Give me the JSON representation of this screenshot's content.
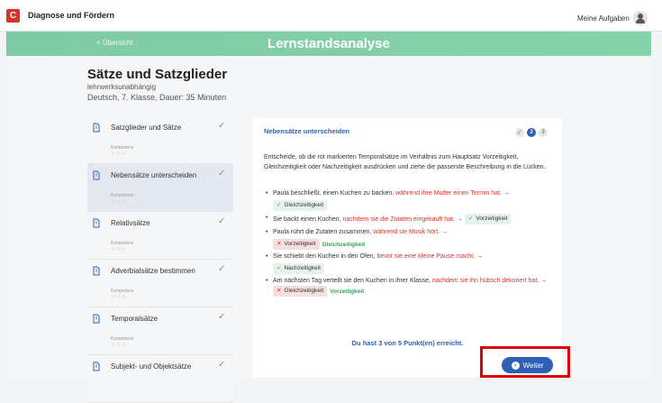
{
  "app": {
    "title": "Diagnose und Fördern",
    "logo_letter": "C",
    "tasks_link": "Meine Aufgaben"
  },
  "header": {
    "back_label": "< Übersicht",
    "title": "Lernstandsanalyse"
  },
  "test": {
    "title": "Sätze und Satzglieder",
    "subtitle": "lehrwerksunabhängig",
    "meta": "Deutsch, 7. Klasse, Dauer: 35 Minuten"
  },
  "sidebar": {
    "items": [
      {
        "label": "Satzglieder und Sätze",
        "competence": "Kompetenz",
        "stars": "☆☆☆",
        "check": "✓"
      },
      {
        "label": "Nebensätze unterscheiden",
        "competence": "Kompetenz",
        "stars": "☆☆☆",
        "check": "✓"
      },
      {
        "label": "Relativsätze",
        "competence": "Kompetenz",
        "stars": "☆☆☆",
        "check": "✓"
      },
      {
        "label": "Adverbialsätze bestimmen",
        "competence": "Kompetenz",
        "stars": "☆☆☆",
        "check": "✓"
      },
      {
        "label": "Temporalsätze",
        "competence": "Kompetenz",
        "stars": "☆☆☆",
        "check": "✓"
      },
      {
        "label": "Subjekt- und Objektsätze",
        "competence": "",
        "stars": "",
        "check": "✓"
      }
    ]
  },
  "task": {
    "title": "Nebensätze unterscheiden",
    "steps": {
      "done": "✓",
      "current": "2",
      "next": "3"
    },
    "intro": "Entscheide, ob die rot markierten Temporalsätze im Verhältnis zum Hauptsatz Vorzeitigkeit, Gleichzeitigkeit oder Nachzeitigkeit ausdrücken und ziehe die passende Beschreibung in die Lücken.",
    "items": [
      {
        "pre": "Paula beschließt, einen Kuchen zu backen, ",
        "red": "während ihre Mutter einen Termin hat.",
        "post": " →",
        "answer": "Gleichzeitigkeit"
      },
      {
        "pre": "Sie backt einen Kuchen, ",
        "red": "nachdem sie die Zutaten eingekauft hat.",
        "post": " →",
        "answer": "Vorzeitigkeit"
      },
      {
        "pre": "Paula rührt die Zutaten zusammen, ",
        "red": "während sie Musik hört.",
        "post": " →",
        "answer": "Vorzeitigkeit",
        "correct": "Gleichzeitigkeit"
      },
      {
        "pre": "Sie schiebt den Kuchen in den Ofen, ",
        "red": "bevor sie eine kleine Pause macht.",
        "post": " →",
        "answer": "Nachzeitigkeit"
      },
      {
        "pre": "Am nächsten Tag verteilt sie den Kuchen in ihrer Klasse, ",
        "red": "nachdem sie ihn hübsch dekoriert hat.",
        "post": " →",
        "answer": "Gleichzeitigkeit",
        "correct": "Vorzeitigkeit"
      }
    ],
    "score": "Du hast 3 von 5 Punkt(en) erreicht.",
    "next_button": "Weiter"
  },
  "colors": {
    "accent": "#2d5fb5",
    "green": "#86d2aa",
    "error": "#d8342c",
    "success": "#3aa05a",
    "highlight": "#e00000"
  },
  "icons": {
    "user": "user-icon",
    "chapter": "book-icon",
    "check": "check-icon",
    "next": "chevron-right-icon"
  }
}
